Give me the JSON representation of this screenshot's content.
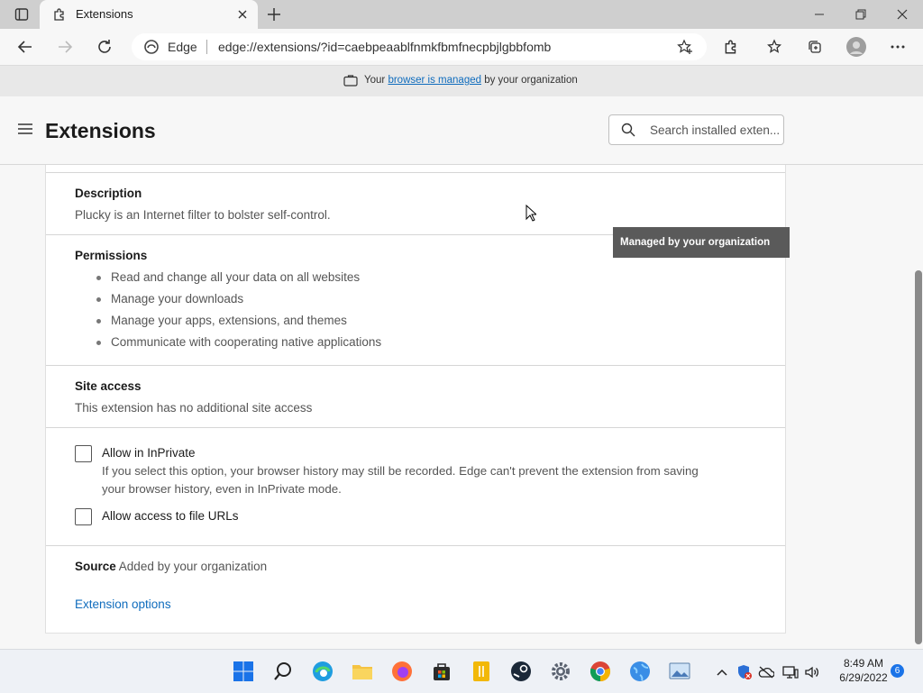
{
  "tab": {
    "title": "Extensions"
  },
  "address": {
    "label": "Edge",
    "url": "edge://extensions/?id=caebpeaablfnmkfbmfnecpbjlgbbfomb"
  },
  "managed_bar": {
    "pre": "Your",
    "link": "browser is managed",
    "post": "by your organization"
  },
  "header": {
    "title": "Extensions",
    "search_placeholder": "Search installed exten..."
  },
  "description": {
    "heading": "Description",
    "text": "Plucky is an Internet filter to bolster self-control."
  },
  "permissions": {
    "heading": "Permissions",
    "items": [
      "Read and change all your data on all websites",
      "Manage your downloads",
      "Manage your apps, extensions, and themes",
      "Communicate with cooperating native applications"
    ]
  },
  "site_access": {
    "heading": "Site access",
    "text": "This extension has no additional site access"
  },
  "options": {
    "inprivate_label": "Allow in InPrivate",
    "inprivate_desc_1": "If you select this option, your browser history may still be recorded. Edge can't prevent the extension from saving",
    "inprivate_desc_2": "your browser history, even in InPrivate mode.",
    "file_urls_label": "Allow access to file URLs"
  },
  "source": {
    "label": "Source",
    "value": "Added by your organization",
    "link": "Extension options"
  },
  "tooltip": {
    "text": "Managed by your organization"
  },
  "taskbar": {
    "time": "8:49 AM",
    "date": "6/29/2022",
    "badge": "6"
  },
  "colors": {
    "accent": "#0f6cbd",
    "tooltip_bg": "#5a5a5a"
  }
}
